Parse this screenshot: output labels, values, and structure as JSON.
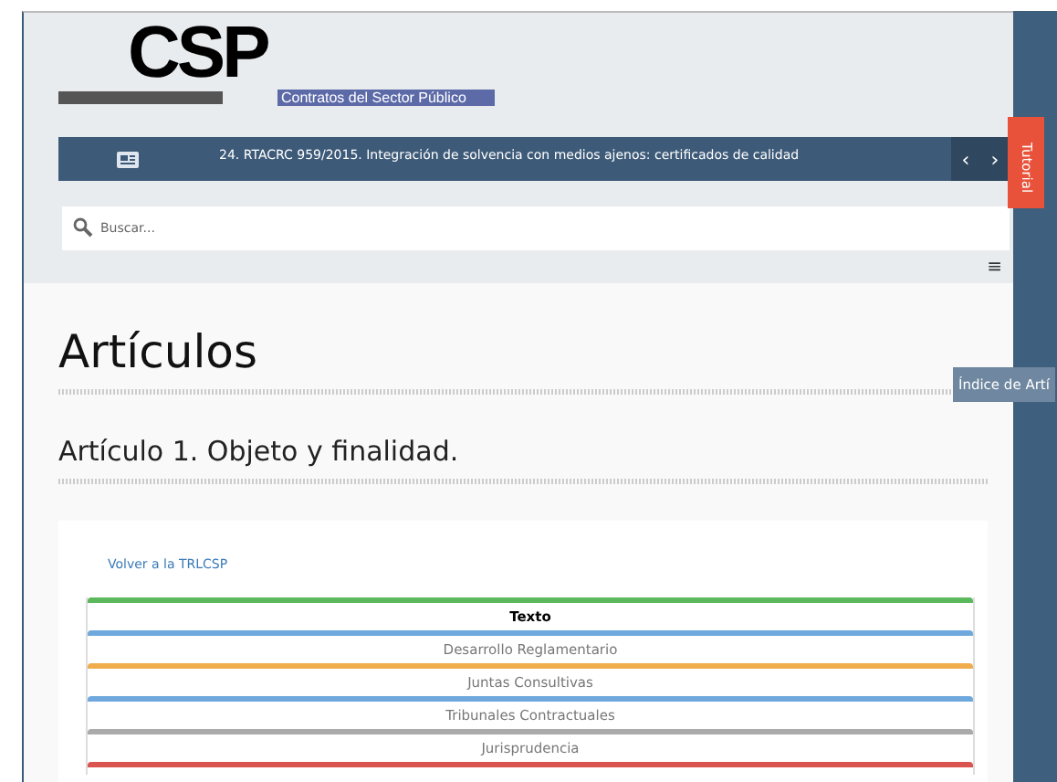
{
  "logo": {
    "mark": "CSP",
    "subtitle": "Contratos del Sector Público"
  },
  "news_ticker": {
    "headline": "24. RTACRC 959/2015. Integración de solvencia con medios ajenos: certificados de calidad",
    "prev": "‹",
    "next": "›"
  },
  "tutorial_tab": {
    "label": "Tutorial"
  },
  "search": {
    "placeholder": "Buscar..."
  },
  "menu_icon": "≡",
  "page_title": "Artículos",
  "index_tab": {
    "label": "Índice de Artí"
  },
  "article_title": "Artículo 1. Objeto y finalidad.",
  "back_link": "Volver a la TRLCSP",
  "tabs": [
    {
      "label": "Texto",
      "selected": true,
      "color": "#5cb85c"
    },
    {
      "label": "Desarrollo Reglamentario",
      "selected": false,
      "color": "#6fa8dc"
    },
    {
      "label": "Juntas Consultivas",
      "selected": false,
      "color": "#f0ad4e"
    },
    {
      "label": "Tribunales Contractuales",
      "selected": false,
      "color": "#6fa8dc"
    },
    {
      "label": "Jurisprudencia",
      "selected": false,
      "color": "#aaaaaa"
    }
  ],
  "partial_tab": {
    "color": "#d9534f"
  }
}
